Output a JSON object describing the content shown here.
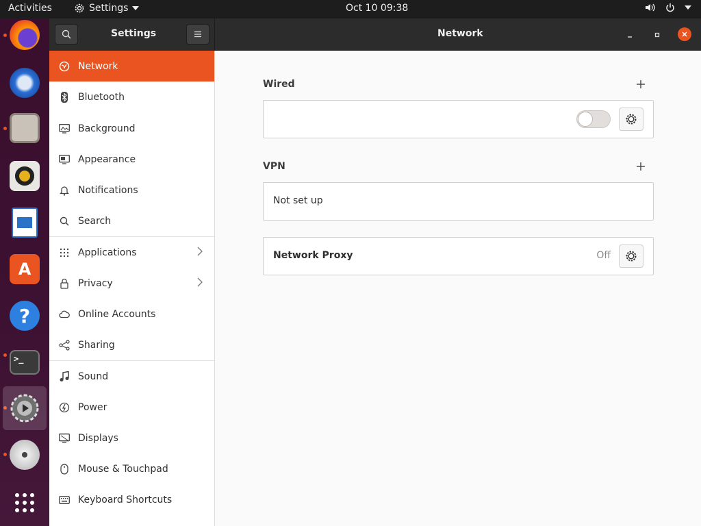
{
  "topbar": {
    "activities": "Activities",
    "app_menu": "Settings",
    "clock": "Oct 10  09:38"
  },
  "dock": {
    "items": [
      {
        "name": "firefox",
        "active": false,
        "running": true
      },
      {
        "name": "thunderbird",
        "active": false,
        "running": false
      },
      {
        "name": "files",
        "active": false,
        "running": true
      },
      {
        "name": "rhythmbox",
        "active": false,
        "running": false
      },
      {
        "name": "libreoffice-writer",
        "active": false,
        "running": false
      },
      {
        "name": "ubuntu-software",
        "active": false,
        "running": false
      },
      {
        "name": "help",
        "active": false,
        "running": false
      },
      {
        "name": "terminal",
        "active": false,
        "running": true
      },
      {
        "name": "settings",
        "active": true,
        "running": true
      },
      {
        "name": "dvd",
        "active": false,
        "running": true
      },
      {
        "name": "show-applications",
        "active": false,
        "running": false
      }
    ]
  },
  "window": {
    "sidebar_title": "Settings",
    "page_title": "Network"
  },
  "sidebar": {
    "items": [
      {
        "label": "Network",
        "icon": "network-icon",
        "selected": true
      },
      {
        "label": "Bluetooth",
        "icon": "bluetooth-icon"
      },
      {
        "label": "Background",
        "icon": "background-icon"
      },
      {
        "label": "Appearance",
        "icon": "appearance-icon"
      },
      {
        "label": "Notifications",
        "icon": "bell-icon"
      },
      {
        "label": "Search",
        "icon": "search-icon"
      },
      {
        "label": "Applications",
        "icon": "applications-icon",
        "chevron": true
      },
      {
        "label": "Privacy",
        "icon": "lock-icon",
        "chevron": true
      },
      {
        "label": "Online Accounts",
        "icon": "cloud-icon"
      },
      {
        "label": "Sharing",
        "icon": "share-icon"
      },
      {
        "label": "Sound",
        "icon": "music-note-icon"
      },
      {
        "label": "Power",
        "icon": "power-icon"
      },
      {
        "label": "Displays",
        "icon": "display-icon"
      },
      {
        "label": "Mouse & Touchpad",
        "icon": "mouse-icon"
      },
      {
        "label": "Keyboard Shortcuts",
        "icon": "keyboard-icon"
      }
    ]
  },
  "content": {
    "wired": {
      "title": "Wired",
      "toggle_on": false
    },
    "vpn": {
      "title": "VPN",
      "empty_text": "Not set up"
    },
    "proxy": {
      "label": "Network Proxy",
      "status": "Off"
    }
  },
  "colors": {
    "accent": "#e95420",
    "headerbar": "#2c2c2c",
    "topbar": "#1d1d1d"
  }
}
